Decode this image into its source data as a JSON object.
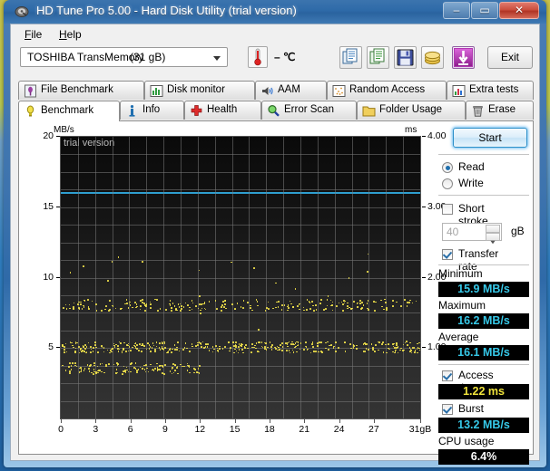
{
  "window": {
    "title": "HD Tune Pro 5.00 - Hard Disk Utility (trial version)",
    "app_icon": "hdtune-icon",
    "minimize_label": "–",
    "maximize_label": "▭",
    "close_label": "✕"
  },
  "menu": [
    {
      "label": "File",
      "mnemonic": "F"
    },
    {
      "label": "Help",
      "mnemonic": "H"
    }
  ],
  "toolbar": {
    "drive_name": "TOSHIBA TransMemory",
    "drive_capacity": "(31 gB)",
    "temperature": "– ℃",
    "temp_icon": "thermometer-icon",
    "buttons": [
      {
        "name": "copy-icon",
        "label": "Copy"
      },
      {
        "name": "copy-image-icon",
        "label": "Copy as image"
      },
      {
        "name": "save-icon",
        "label": "Save"
      },
      {
        "name": "coins-icon",
        "label": "Buy"
      },
      {
        "name": "download-arrow-icon",
        "label": "Download"
      }
    ],
    "exit_label": "Exit"
  },
  "tabs_row1": [
    {
      "label": "File Benchmark",
      "icon": "file-benchmark-icon",
      "active": false
    },
    {
      "label": "Disk monitor",
      "icon": "disk-monitor-icon",
      "active": false
    },
    {
      "label": "AAM",
      "icon": "speaker-icon",
      "active": false
    },
    {
      "label": "Random Access",
      "icon": "random-access-icon",
      "active": false
    },
    {
      "label": "Extra tests",
      "icon": "extra-tests-icon",
      "active": false
    }
  ],
  "tabs_row2": [
    {
      "label": "Benchmark",
      "icon": "lightbulb-icon",
      "active": true
    },
    {
      "label": "Info",
      "icon": "info-icon",
      "active": false
    },
    {
      "label": "Health",
      "icon": "health-cross-icon",
      "active": false
    },
    {
      "label": "Error Scan",
      "icon": "magnifier-icon",
      "active": false
    },
    {
      "label": "Folder Usage",
      "icon": "folder-icon",
      "active": false
    },
    {
      "label": "Erase",
      "icon": "trash-icon",
      "active": false
    }
  ],
  "sidebar": {
    "start_label": "Start",
    "mode": {
      "read_label": "Read",
      "write_label": "Write",
      "selected": "Read"
    },
    "short_stroke": {
      "label": "Short stroke",
      "checked": false,
      "value": "40",
      "unit": "gB"
    },
    "transfer_rate": {
      "label": "Transfer rate",
      "checked": true
    },
    "minimum": {
      "label": "Minimum",
      "value": "15.9 MB/s"
    },
    "maximum": {
      "label": "Maximum",
      "value": "16.2 MB/s"
    },
    "average": {
      "label": "Average",
      "value": "16.1 MB/s"
    },
    "access_time": {
      "label": "Access time",
      "checked": true,
      "value": "1.22 ms"
    },
    "burst_rate": {
      "label": "Burst rate",
      "checked": true,
      "value": "13.2 MB/s"
    },
    "cpu_usage": {
      "label": "CPU usage",
      "value": "6.4%"
    }
  },
  "colors": {
    "transfer_line": "#2f9fd0",
    "access_dots": "#f2e34a",
    "value_cyan": "#36c8e8",
    "value_yellow": "#f0e33c",
    "value_white": "#ffffff",
    "titlebar": "#2e6aa8",
    "close_button": "#cc4f3e"
  },
  "chart_data": {
    "type": "line",
    "title": "",
    "watermark": "trial version",
    "xlabel": "",
    "ylabel": "MB/s",
    "y2label": "ms",
    "xlim": [
      0,
      31
    ],
    "ylim": [
      0,
      20
    ],
    "y2lim": [
      0,
      4.0
    ],
    "x_ticks": [
      0,
      3,
      6,
      9,
      12,
      15,
      18,
      21,
      24,
      27,
      31
    ],
    "x_tick_labels": [
      "0",
      "3",
      "6",
      "9",
      "12",
      "15",
      "18",
      "21",
      "24",
      "27",
      "31gB"
    ],
    "y_ticks": [
      5,
      10,
      15,
      20
    ],
    "y_tick_labels": [
      "5",
      "10",
      "15",
      "20"
    ],
    "y2_ticks": [
      1.0,
      2.0,
      3.0,
      4.0
    ],
    "y2_tick_labels": [
      "1.00",
      "2.00",
      "3.00",
      "4.00"
    ],
    "grid": true,
    "legend": "none",
    "series": [
      {
        "name": "Transfer rate",
        "type": "line",
        "axis": "left",
        "unit": "MB/s",
        "color": "#2f9fd0",
        "constant_value": 16.1,
        "min": 15.9,
        "max": 16.2,
        "average": 16.1
      },
      {
        "name": "Access time",
        "type": "scatter",
        "axis": "right",
        "unit": "ms",
        "color": "#f2e34a",
        "average": 1.22,
        "bands": [
          {
            "ms": 1.62,
            "x_from": 0,
            "x_to": 31,
            "density": 0.55
          },
          {
            "ms": 1.02,
            "x_from": 0,
            "x_to": 31,
            "density": 0.9
          },
          {
            "ms": 0.72,
            "x_from": 0,
            "x_to": 12,
            "density": 0.85
          }
        ]
      }
    ]
  }
}
